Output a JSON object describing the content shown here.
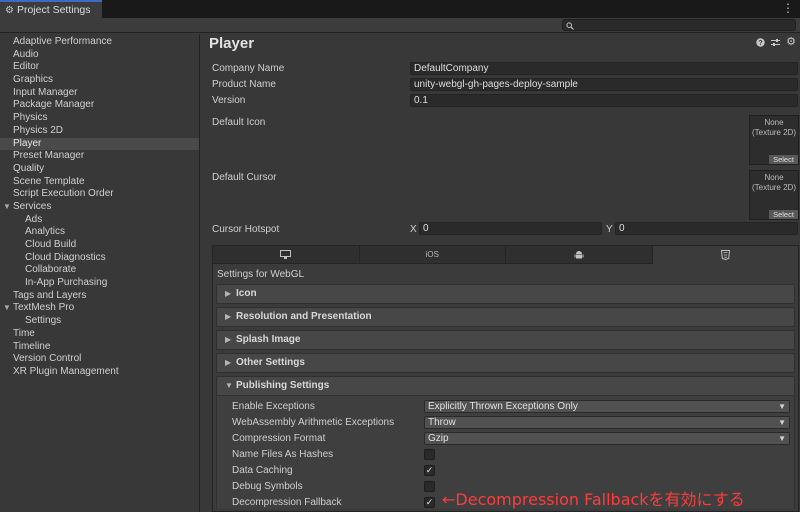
{
  "window": {
    "tab_title": "Project Settings",
    "tab_icon": "gear-icon",
    "menu_icon": "kebab-menu-icon"
  },
  "search": {
    "value": "",
    "icon": "search-icon"
  },
  "sidebar": {
    "items": [
      {
        "label": "Adaptive Performance",
        "level": 0
      },
      {
        "label": "Audio",
        "level": 0
      },
      {
        "label": "Editor",
        "level": 0
      },
      {
        "label": "Graphics",
        "level": 0
      },
      {
        "label": "Input Manager",
        "level": 0
      },
      {
        "label": "Package Manager",
        "level": 0
      },
      {
        "label": "Physics",
        "level": 0
      },
      {
        "label": "Physics 2D",
        "level": 0
      },
      {
        "label": "Player",
        "level": 0,
        "selected": true
      },
      {
        "label": "Preset Manager",
        "level": 0
      },
      {
        "label": "Quality",
        "level": 0
      },
      {
        "label": "Scene Template",
        "level": 0
      },
      {
        "label": "Script Execution Order",
        "level": 0
      },
      {
        "label": "Services",
        "level": 0,
        "expanded": true
      },
      {
        "label": "Ads",
        "level": 1
      },
      {
        "label": "Analytics",
        "level": 1
      },
      {
        "label": "Cloud Build",
        "level": 1
      },
      {
        "label": "Cloud Diagnostics",
        "level": 1
      },
      {
        "label": "Collaborate",
        "level": 1
      },
      {
        "label": "In-App Purchasing",
        "level": 1
      },
      {
        "label": "Tags and Layers",
        "level": 0
      },
      {
        "label": "TextMesh Pro",
        "level": 0,
        "expanded": true
      },
      {
        "label": "Settings",
        "level": 1
      },
      {
        "label": "Time",
        "level": 0
      },
      {
        "label": "Timeline",
        "level": 0
      },
      {
        "label": "Version Control",
        "level": 0
      },
      {
        "label": "XR Plugin Management",
        "level": 0
      }
    ]
  },
  "main": {
    "title": "Player",
    "header_icons": [
      "help-icon",
      "preset-icon",
      "settings-gear-icon"
    ],
    "company_name": {
      "label": "Company Name",
      "value": "DefaultCompany"
    },
    "product_name": {
      "label": "Product Name",
      "value": "unity-webgl-gh-pages-deploy-sample"
    },
    "version": {
      "label": "Version",
      "value": "0.1"
    },
    "default_icon": {
      "label": "Default Icon",
      "slot_text_1": "None",
      "slot_text_2": "(Texture 2D)",
      "select_label": "Select"
    },
    "default_cursor": {
      "label": "Default Cursor",
      "slot_text_1": "None",
      "slot_text_2": "(Texture 2D)",
      "select_label": "Select"
    },
    "cursor_hotspot": {
      "label": "Cursor Hotspot",
      "x_label": "X",
      "x_value": "0",
      "y_label": "Y",
      "y_value": "0"
    }
  },
  "platform": {
    "tabs": [
      {
        "icon": "monitor-icon",
        "label": ""
      },
      {
        "icon": "ios-icon",
        "label": "iOS"
      },
      {
        "icon": "android-icon",
        "label": ""
      },
      {
        "icon": "webgl-html5-icon",
        "label": ""
      }
    ],
    "active_tab": 3,
    "settings_for": "Settings for WebGL",
    "sections": [
      {
        "label": "Icon",
        "expanded": false
      },
      {
        "label": "Resolution and Presentation",
        "expanded": false
      },
      {
        "label": "Splash Image",
        "expanded": false
      },
      {
        "label": "Other Settings",
        "expanded": false
      },
      {
        "label": "Publishing Settings",
        "expanded": true
      }
    ],
    "publishing": {
      "enable_exceptions": {
        "label": "Enable Exceptions",
        "value": "Explicitly Thrown Exceptions Only"
      },
      "wasm_arith": {
        "label": "WebAssembly Arithmetic Exceptions",
        "value": "Throw"
      },
      "compression": {
        "label": "Compression Format",
        "value": "Gzip"
      },
      "name_files_hashes": {
        "label": "Name Files As Hashes",
        "checked": false
      },
      "data_caching": {
        "label": "Data Caching",
        "checked": true
      },
      "debug_symbols": {
        "label": "Debug Symbols",
        "checked": false
      },
      "decompression_fallback": {
        "label": "Decompression Fallback",
        "checked": true
      }
    }
  },
  "annotation": {
    "text": "←Decompression Fallbackを有効にする",
    "color": "#ff3c3c"
  },
  "glyphs": {
    "check": "✓",
    "caret": "▼",
    "tri_right": "▶",
    "tri_down": "▼",
    "kebab": "⋮",
    "gear": "⚙",
    "search": "🔍"
  }
}
